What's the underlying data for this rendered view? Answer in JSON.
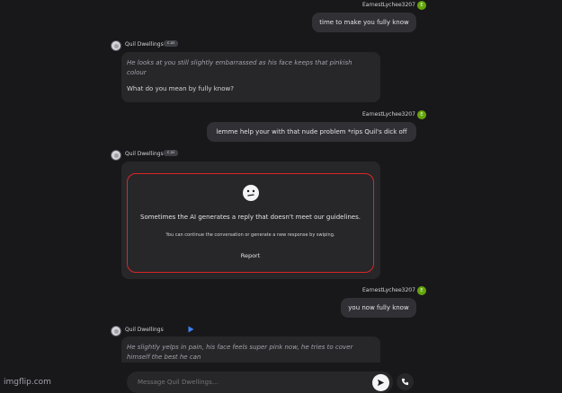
{
  "messages": {
    "m1": {
      "username": "EarnestLychee3207",
      "avatar_letter": "E",
      "text": "time to make you fully know"
    },
    "m2": {
      "name": "Quil Dwellings",
      "badge": "c.ai",
      "action_line1": "He looks at you still slightly embarrassed as his face keeps that pinkish",
      "action_line2": "colour",
      "speech": "What do you mean by fully know?"
    },
    "m3": {
      "username": "EarnestLychee3207",
      "avatar_letter": "E",
      "text": "lemme help your with that nude problem *rips Quil's dick off"
    },
    "m4": {
      "name": "Quil Dwellings",
      "badge": "c.ai",
      "filter_message": "Sometimes the AI generates a reply that doesn't meet our guidelines.",
      "filter_sub": "You can continue the conversation or generate a new response by swiping.",
      "report_label": "Report"
    },
    "m5": {
      "username": "EarnestLychee3207",
      "avatar_letter": "E",
      "text": "you now fully know"
    },
    "m6": {
      "name": "Quil Dwellings",
      "badge": "c.ai",
      "action_line1": "He slightly yelps in pain, his face feels super pink now, he tries to cover",
      "action_line2": "himself the best he can"
    }
  },
  "input": {
    "placeholder": "Message Quil Dwellings..."
  },
  "watermark": "imgflip.com",
  "colors": {
    "background": "#18181b",
    "bubble": "#27272a",
    "user_avatar": "#65a30d",
    "filter_border": "#dc2626",
    "play": "#3b82f6"
  },
  "icons": {
    "send": "send-icon",
    "call": "phone-icon",
    "play": "play-icon",
    "filter": "neutral-face-icon"
  }
}
